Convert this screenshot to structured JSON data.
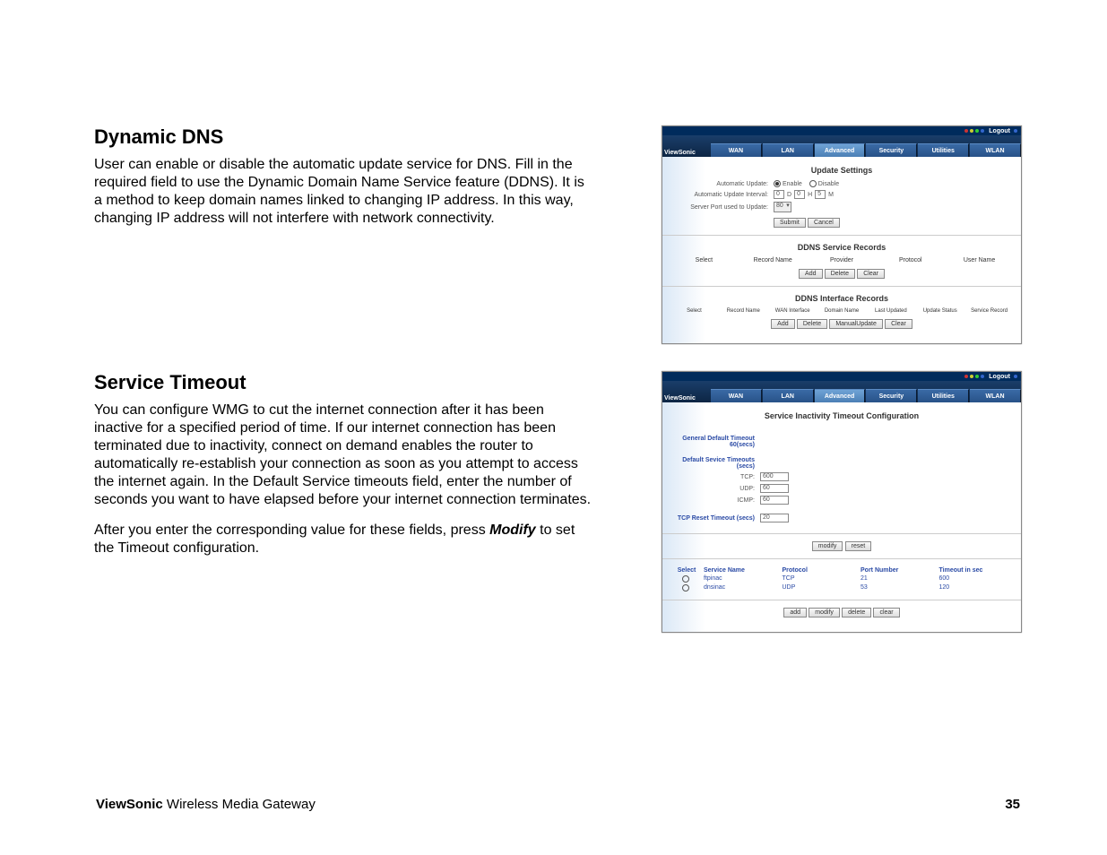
{
  "section1": {
    "heading": "Dynamic DNS",
    "paragraph": "User can enable or disable the automatic update service for DNS.  Fill in the required field to use the Dynamic Domain Name Service feature (DDNS).  It is a method to keep domain names linked to changing IP address.  In this way, changing IP address will not interfere with network connectivity."
  },
  "section2": {
    "heading": "Service Timeout",
    "paragraph1": "You can configure WMG to cut the internet connection after it has been inactive for a specified period of time.  If our internet connection has been terminated due to inactivity, connect on demand enables the router to automatically re-establish your connection as soon as you attempt to access the internet again.  In the Default Service timeouts field, enter the number of seconds you want to have elapsed before your internet connection terminates.",
    "paragraph2_pre": "After you enter the corresponding value for these fields, press ",
    "paragraph2_bold": "Modify",
    "paragraph2_post": " to set the Timeout configuration."
  },
  "footer": {
    "brand": "ViewSonic",
    "product": " Wireless Media Gateway",
    "page": "35"
  },
  "shot1": {
    "logout": "Logout",
    "logo": "ViewSonic",
    "tabs": [
      "WAN",
      "LAN",
      "Advanced",
      "Security",
      "Utilities",
      "WLAN"
    ],
    "active_tab_index": 2,
    "title": "Update Settings",
    "f1_label": "Automatic Update:",
    "f1_opt1": "Enable",
    "f1_opt2": "Disable",
    "f2_label": "Automatic Update Interval:",
    "f2_d": "0",
    "f2_dL": "D",
    "f2_h": "0",
    "f2_hL": "H",
    "f2_m": "5",
    "f2_mL": "M",
    "f3_label": "Server Port used to Update:",
    "f3_val": "80",
    "submit": "Submit",
    "cancel": "Cancel",
    "sec2_title": "DDNS Service Records",
    "sec2_cols": [
      "Select",
      "Record Name",
      "Provider",
      "Protocol",
      "User Name"
    ],
    "add": "Add",
    "delete": "Delete",
    "clear": "Clear",
    "sec3_title": "DDNS Interface Records",
    "sec3_cols": [
      "Select",
      "Record Name",
      "WAN Interface",
      "Domain Name",
      "Last Updated",
      "Update Status",
      "Service Record"
    ],
    "manual": "ManualUpdate"
  },
  "shot2": {
    "logout": "Logout",
    "logo": "ViewSonic",
    "tabs": [
      "WAN",
      "LAN",
      "Advanced",
      "Security",
      "Utilities",
      "WLAN"
    ],
    "active_tab_index": 2,
    "title": "Service Inactivity Timeout Configuration",
    "g1": "General Default Timeout 60(secs)",
    "g2": "Default Sevice Timeouts (secs)",
    "tcp_l": "TCP:",
    "tcp_v": "600",
    "udp_l": "UDP:",
    "udp_v": "60",
    "icmp_l": "ICMP:",
    "icmp_v": "60",
    "g3": "TCP Reset Timeout (secs)",
    "g3_v": "20",
    "modify": "modify",
    "reset": "reset",
    "table_cols": [
      "Select",
      "Service Name",
      "Protocol",
      "Port Number",
      "Timeout in sec"
    ],
    "rows": [
      {
        "name": "ftpinac",
        "proto": "TCP",
        "port": "21",
        "timeout": "600"
      },
      {
        "name": "dnsinac",
        "proto": "UDP",
        "port": "53",
        "timeout": "120"
      }
    ],
    "add": "add",
    "modify2": "modify",
    "delete": "delete",
    "clear": "clear"
  }
}
